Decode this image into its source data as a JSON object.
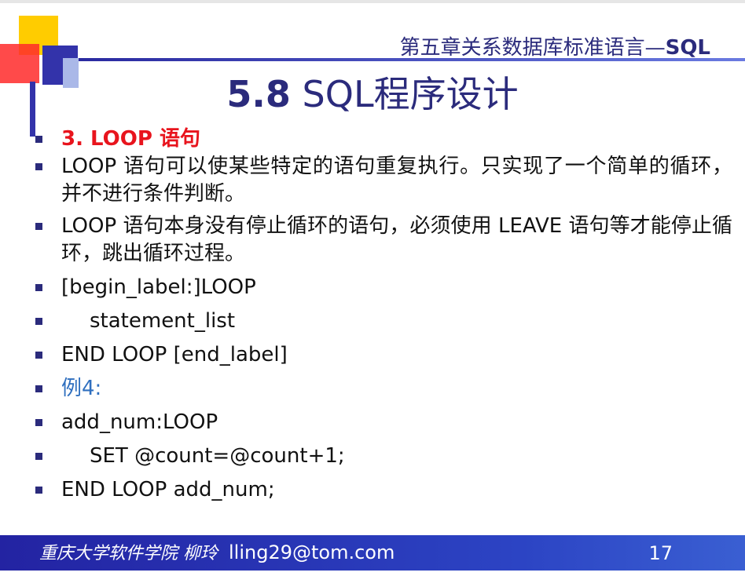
{
  "header": {
    "chapter_cn": "第五章关系数据库标准语言—",
    "chapter_en": "SQL",
    "title_num": "5.8",
    "title_text": " SQL程序设计"
  },
  "items": [
    "3. LOOP 语句",
    "LOOP 语句可以使某些特定的语句重复执行。只实现了一个简单的循环，并不进行条件判断。",
    "LOOP 语句本身没有停止循环的语句，必须使用 LEAVE 语句等才能停止循环，跳出循环过程。",
    "[begin_label:]LOOP",
    "statement_list",
    "END LOOP [end_label]",
    "例4:",
    "add_num:LOOP",
    "SET @count=@count+1;",
    "END LOOP add_num;"
  ],
  "footer": {
    "author": "重庆大学软件学院  柳玲",
    "email": "lling29@tom.com",
    "page": "17"
  },
  "colors": {
    "title": "#2b2b7c",
    "heading_red": "#e8141d",
    "example_blue": "#2f6fbf",
    "footer_bg": "#2323a2"
  }
}
